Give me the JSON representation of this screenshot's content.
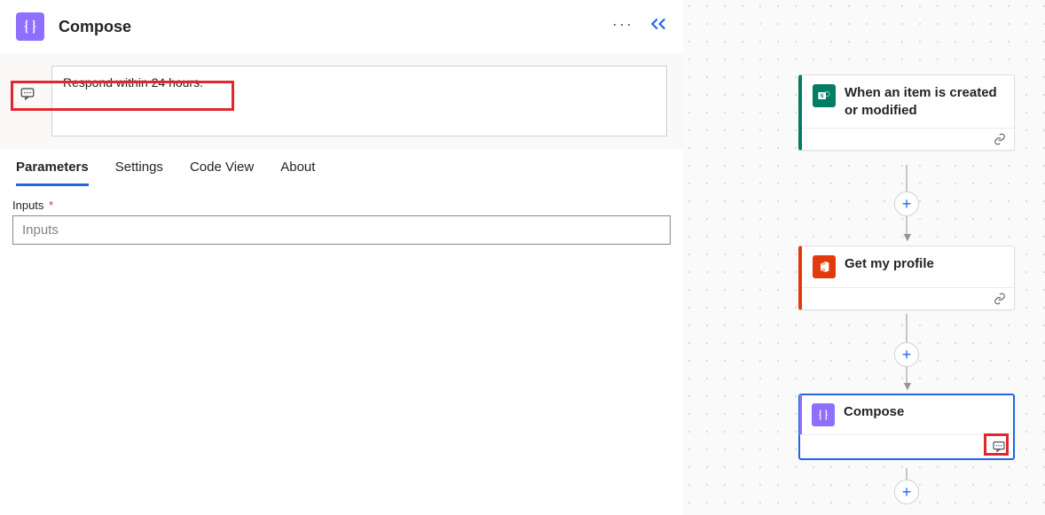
{
  "header": {
    "title": "Compose"
  },
  "note": {
    "text": "Respond within 24 hours."
  },
  "tabs": {
    "parameters": "Parameters",
    "settings": "Settings",
    "code_view": "Code View",
    "about": "About"
  },
  "form": {
    "inputs_label": "Inputs",
    "inputs_placeholder": "Inputs"
  },
  "flow": {
    "cards": [
      {
        "title": "When an item is created or modified"
      },
      {
        "title": "Get my profile"
      },
      {
        "title": "Compose"
      }
    ]
  }
}
